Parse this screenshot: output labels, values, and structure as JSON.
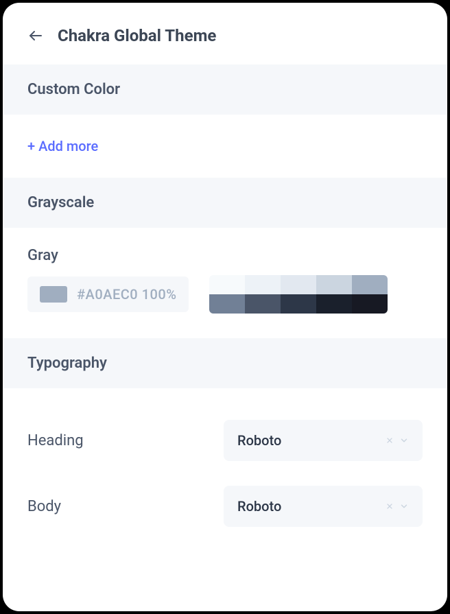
{
  "header": {
    "title": "Chakra Global Theme"
  },
  "sections": {
    "customColor": {
      "title": "Custom Color",
      "addMoreLabel": "+ Add more"
    },
    "grayscale": {
      "title": "Grayscale",
      "colorName": "Gray",
      "colorHex": "#A0AEC0 100%",
      "swatchColor": "#a0aec0",
      "palette": [
        "#f7fafc",
        "#edf2f7",
        "#e2e8f0",
        "#cbd5e0",
        "#a0aec0",
        "#718096",
        "#4a5568",
        "#2d3748",
        "#1a202c",
        "#171923"
      ]
    },
    "typography": {
      "title": "Typography",
      "heading": {
        "label": "Heading",
        "value": "Roboto"
      },
      "body": {
        "label": "Body",
        "value": "Roboto"
      }
    }
  }
}
